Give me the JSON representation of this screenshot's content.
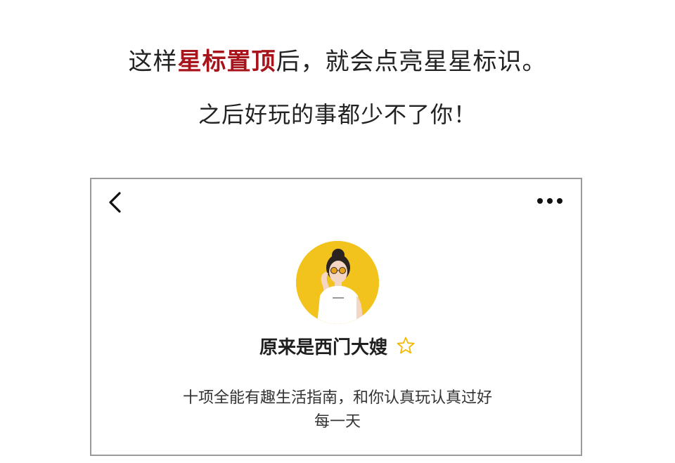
{
  "headline": {
    "prefix": "这样",
    "highlight": "星标置顶",
    "suffix": "后，就会点亮星星标识。"
  },
  "subline": "之后好玩的事都少不了你！",
  "profile": {
    "back_icon": "chevron-left-icon",
    "more_icon": "more-horizontal-icon",
    "avatar": "avatar",
    "name": "原来是西门大嫂",
    "star_icon": "star-outline-icon",
    "star_color": "#f5b800",
    "intro_line1": "十项全能有趣生活指南，和你认真玩认真过好",
    "intro_line2": "每一天"
  },
  "colors": {
    "highlight": "#a8141b",
    "avatar_bg": "#f2c31c",
    "frame_border": "#9a9a9a"
  }
}
